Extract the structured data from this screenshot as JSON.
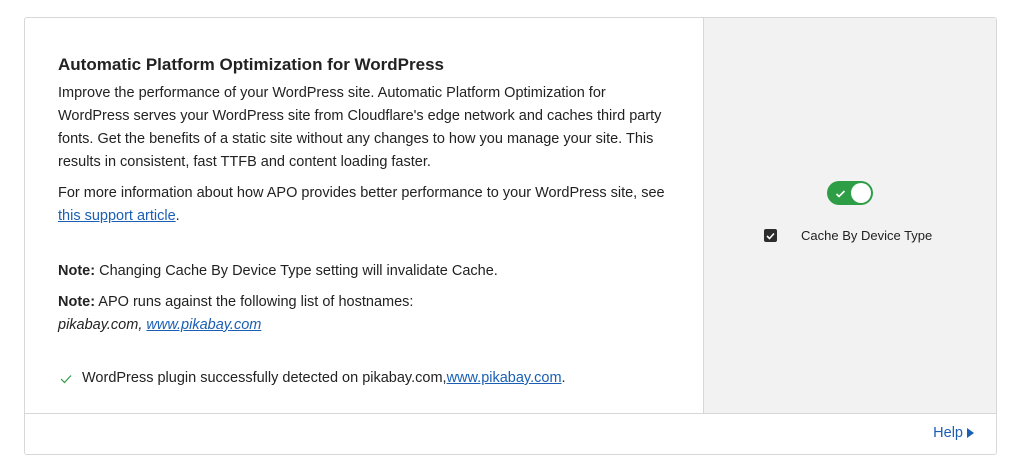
{
  "card": {
    "title": "Automatic Platform Optimization for WordPress",
    "description": "Improve the performance of your WordPress site. Automatic Platform Optimization for WordPress serves your WordPress site from Cloudflare's edge network and caches third party fonts. Get the benefits of a static site without any changes to how you manage your site. This results in consistent, fast TTFB and content loading faster.",
    "more_info_prefix": "For more information about how APO provides better performance to your WordPress site, see ",
    "more_info_link": "this support article",
    "more_info_suffix": ".",
    "note1_label": "Note:",
    "note1_text": " Changing Cache By Device Type setting will invalidate Cache.",
    "note2_label": "Note:",
    "note2_text": " APO runs against the following list of hostnames:",
    "hosts_plain": "pikabay.com, ",
    "hosts_link": "www.pikabay.com",
    "detected_text": "WordPress plugin successfully detected on pikabay.com, ",
    "detected_link": "www.pikabay.com",
    "detected_suffix": "."
  },
  "side": {
    "apo_toggle_on": true,
    "cache_by_device_type_label": "Cache By Device Type",
    "cache_by_device_type_checked": true
  },
  "footer": {
    "help_label": "Help"
  },
  "colors": {
    "toggle_on": "#2e9e46",
    "link": "#1a5fb4",
    "side_bg": "#f2f2f2",
    "check_green": "#2e9e46"
  }
}
